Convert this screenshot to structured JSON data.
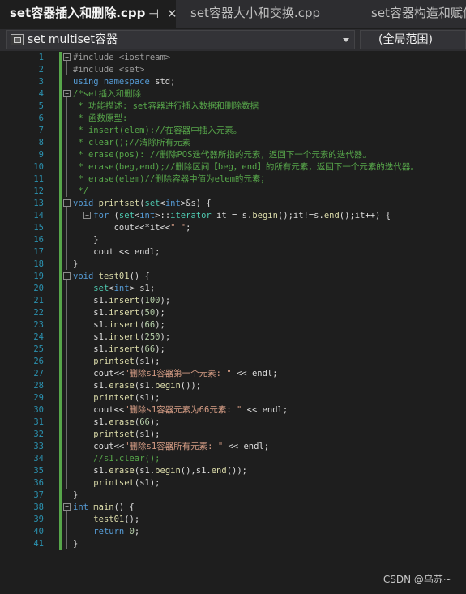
{
  "tabs": [
    {
      "label": "set容器插入和删除.cpp",
      "active": true,
      "pin_icon": "⊣",
      "close_icon": "✕"
    },
    {
      "label": "set容器大小和交换.cpp",
      "active": false
    },
    {
      "label": "set容器构造和赋值",
      "active": false
    }
  ],
  "navbar": {
    "scope": "set multiset容器",
    "member": "(全局范围)"
  },
  "code_lines": [
    {
      "n": "1",
      "html": "<span class='pp'>#include &lt;iostream&gt;</span>"
    },
    {
      "n": "2",
      "html": "<span class='pp'>#include &lt;set&gt;</span>"
    },
    {
      "n": "3",
      "html": "<span class='kw'>using namespace</span> std;"
    },
    {
      "n": "4",
      "html": "<span class='cm'>/*set插入和删除</span>"
    },
    {
      "n": "5",
      "html": "<span class='cm'> * 功能描述: set容器进行插入数据和删除数据</span>"
    },
    {
      "n": "6",
      "html": "<span class='cm'> * 函数原型:</span>"
    },
    {
      "n": "7",
      "html": "<span class='cm'> * insert(elem)://在容器中插入元素。</span>"
    },
    {
      "n": "8",
      "html": "<span class='cm'> * clear();//清除所有元素</span>"
    },
    {
      "n": "9",
      "html": "<span class='cm'> * erase(pos): //删除POS迭代器所指的元素，返回下一个元素的迭代器。</span>"
    },
    {
      "n": "10",
      "html": "<span class='cm'> * erase(beg,end);//删除区间【beg，end】的所有元素，返回下一个元素的迭代器。</span>"
    },
    {
      "n": "11",
      "html": "<span class='cm'> * erase(elem)//删除容器中值为elem的元素；</span>"
    },
    {
      "n": "12",
      "html": "<span class='cm'> */</span>"
    },
    {
      "n": "13",
      "html": "<span class='kw'>void</span> <span class='fn'>printset</span>(<span class='ty'>set</span>&lt;<span class='kw'>int</span>&gt;&amp;s) {"
    },
    {
      "n": "14",
      "html": "    <span class='kw'>for</span> (<span class='ty'>set</span>&lt;<span class='kw'>int</span>&gt;::<span class='ty'>iterator</span> it = s.<span class='fn'>begin</span>();it!=s.<span class='fn'>end</span>();it++) {"
    },
    {
      "n": "15",
      "html": "        cout&lt;&lt;*it&lt;&lt;<span class='str'>\" \"</span>;"
    },
    {
      "n": "16",
      "html": "    }"
    },
    {
      "n": "17",
      "html": "    cout &lt;&lt; endl;"
    },
    {
      "n": "18",
      "html": "}"
    },
    {
      "n": "19",
      "html": "<span class='kw'>void</span> <span class='fn'>test01</span>() {"
    },
    {
      "n": "20",
      "html": "    <span class='ty'>set</span>&lt;<span class='kw'>int</span>&gt; s1;"
    },
    {
      "n": "21",
      "html": "    s1.<span class='fn'>insert</span>(<span class='num'>100</span>);"
    },
    {
      "n": "22",
      "html": "    s1.<span class='fn'>insert</span>(<span class='num'>50</span>);"
    },
    {
      "n": "23",
      "html": "    s1.<span class='fn'>insert</span>(<span class='num'>66</span>);"
    },
    {
      "n": "24",
      "html": "    s1.<span class='fn'>insert</span>(<span class='num'>250</span>);"
    },
    {
      "n": "25",
      "html": "    s1.<span class='fn'>insert</span>(<span class='num'>66</span>);"
    },
    {
      "n": "26",
      "html": "    <span class='fn'>printset</span>(s1);"
    },
    {
      "n": "27",
      "html": "    cout&lt;&lt;<span class='str'>\"删除s1容器第一个元素: \"</span> &lt;&lt; endl;"
    },
    {
      "n": "28",
      "html": "    s1.<span class='fn'>erase</span>(s1.<span class='fn'>begin</span>());"
    },
    {
      "n": "29",
      "html": "    <span class='fn'>printset</span>(s1);"
    },
    {
      "n": "30",
      "html": "    cout&lt;&lt;<span class='str'>\"删除s1容器元素为66元素: \"</span> &lt;&lt; endl;"
    },
    {
      "n": "31",
      "html": "    s1.<span class='fn'>erase</span>(<span class='num'>66</span>);"
    },
    {
      "n": "32",
      "html": "    <span class='fn'>printset</span>(s1);"
    },
    {
      "n": "33",
      "html": "    cout&lt;&lt;<span class='str'>\"删除s1容器所有元素: \"</span> &lt;&lt; endl;"
    },
    {
      "n": "34",
      "html": "    <span class='cm'>//s1.clear();</span>"
    },
    {
      "n": "35",
      "html": "    s1.<span class='fn'>erase</span>(s1.<span class='fn'>begin</span>(),s1.<span class='fn'>end</span>());"
    },
    {
      "n": "36",
      "html": "    <span class='fn'>printset</span>(s1);"
    },
    {
      "n": "37",
      "html": "}"
    },
    {
      "n": "38",
      "html": "<span class='kw'>int</span> <span class='fn'>main</span>() {"
    },
    {
      "n": "39",
      "html": "    <span class='fn'>test01</span>();"
    },
    {
      "n": "40",
      "html": "    <span class='kw'>return</span> <span class='num'>0</span>;"
    },
    {
      "n": "41",
      "html": "}"
    }
  ],
  "watermark": "CSDN @乌苏~"
}
